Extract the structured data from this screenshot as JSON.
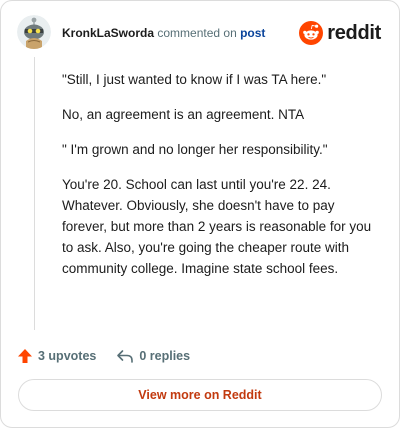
{
  "comment": {
    "username": "KronkLaSworda",
    "action_text": "commented on",
    "link_text": "post"
  },
  "brand": {
    "wordmark": "reddit",
    "accent_color": "#ff4500"
  },
  "body": {
    "paragraphs": [
      "\"Still, I just wanted to know if I was TA here.\"",
      "No, an agreement is an agreement. NTA",
      "\" I'm grown and no longer her responsibility.\"",
      "You're 20. School can last until you're 22. 24. Whatever. Obviously, she doesn't have to pay forever, but more than 2 years is reasonable for you to ask. Also, you're going the cheaper route with community college. Imagine state school fees."
    ]
  },
  "stats": {
    "upvotes": "3 upvotes",
    "replies": "0 replies"
  },
  "cta": {
    "label": "View more on Reddit"
  },
  "icons": {
    "avatar": "snoo-avatar",
    "logo": "reddit-logo-icon",
    "upvote": "upvote-arrow-icon",
    "reply": "reply-arrow-icon"
  }
}
